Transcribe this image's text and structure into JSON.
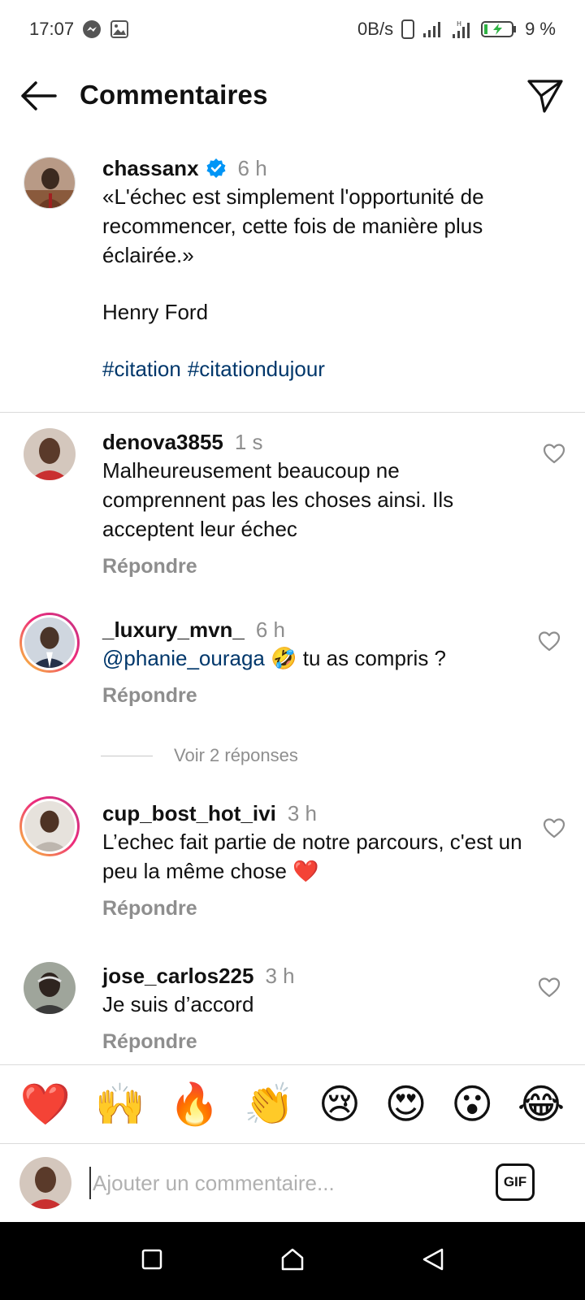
{
  "status_bar": {
    "time": "17:07",
    "net_speed": "0B/s",
    "battery": "9 %",
    "icons": [
      "messenger-icon",
      "image-icon",
      "phone-icon",
      "signal-icon",
      "signal-h-icon",
      "battery-icon"
    ]
  },
  "header": {
    "title": "Commentaires",
    "back_icon": "arrow-left-icon",
    "send_icon": "paper-plane-icon"
  },
  "caption": {
    "username": "chassanx",
    "verified": true,
    "time": "6 h",
    "text": "«L'échec est simplement l'opportunité de recommencer, cette fois de manière plus éclairée.»",
    "author": "Henry Ford",
    "hashtags": [
      "#citation",
      "#citationdujour"
    ]
  },
  "comments": [
    {
      "username": "denova3855",
      "time": "1 s",
      "text": "Malheureusement beaucoup ne comprennent pas les choses ainsi. Ils acceptent leur échec",
      "reply_label": "Répondre"
    },
    {
      "username": "_luxury_mvn_",
      "time": "6 h",
      "mention": "@phanie_ouraga",
      "emoji": "🤣",
      "text": "tu as compris ?",
      "reply_label": "Répondre"
    },
    {
      "username": "cup_bost_hot_ivi",
      "time": "3 h",
      "text": "L’echec fait partie de notre parcours, c'est un peu la même chose",
      "emoji": "❤️",
      "reply_label": "Répondre"
    },
    {
      "username": "jose_carlos225",
      "time": "3 h",
      "text": "Je suis d’accord",
      "reply_label": "Répondre"
    }
  ],
  "view_replies": "Voir 2 réponses",
  "emoji_bar": [
    "❤️",
    "🙌",
    "🔥",
    "👏",
    "😢",
    "😍",
    "😮",
    "😂"
  ],
  "composer": {
    "placeholder": "Ajouter un commentaire...",
    "gif_label": "GIF"
  },
  "nav_bar": {
    "icons": [
      "square-icon",
      "home-icon",
      "back-triangle-icon"
    ]
  },
  "colors": {
    "link": "#00376b",
    "muted": "#8e8e8e",
    "verified": "#0095f6",
    "heart": "#ed4956"
  }
}
